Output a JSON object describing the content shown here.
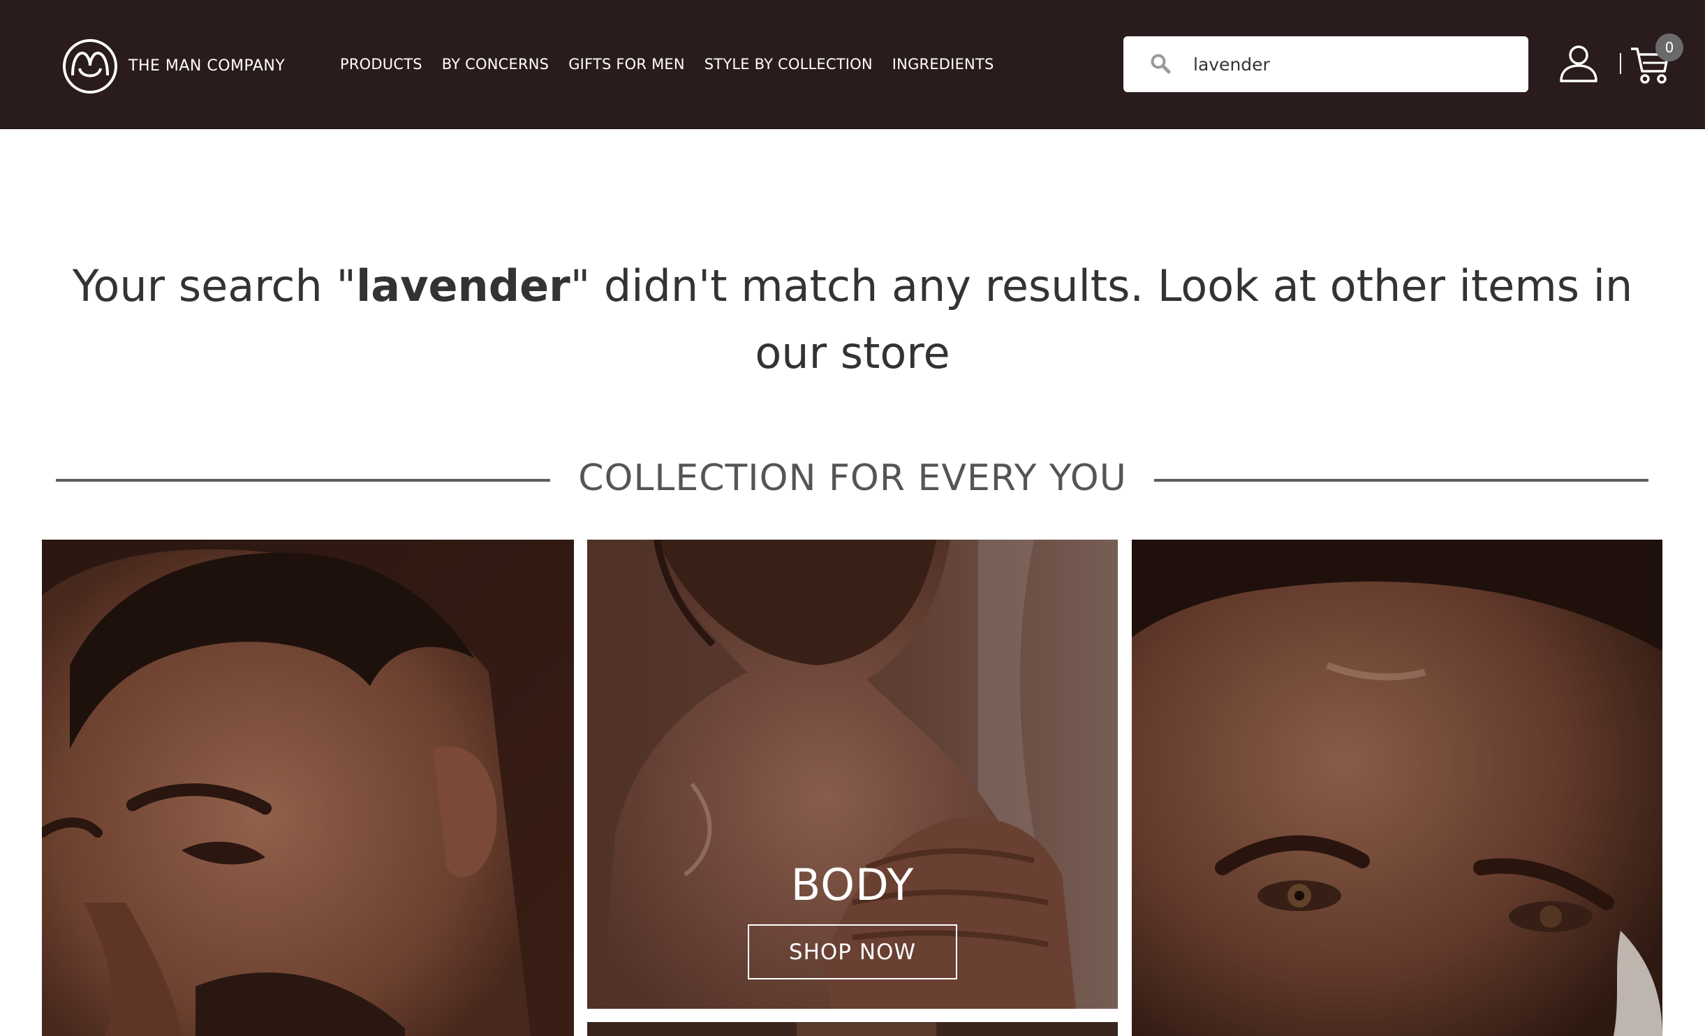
{
  "brand": {
    "name": "THE MAN COMPANY"
  },
  "nav": {
    "items": [
      {
        "label": "PRODUCTS"
      },
      {
        "label": "BY CONCERNS"
      },
      {
        "label": "GIFTS FOR MEN"
      },
      {
        "label": "STYLE BY COLLECTION"
      },
      {
        "label": "INGREDIENTS"
      }
    ]
  },
  "search": {
    "value": "lavender"
  },
  "cart": {
    "count": "0"
  },
  "message": {
    "prefix": "Your search \"",
    "query": "lavender",
    "suffix": "\" didn't match any results. Look at other items in our store"
  },
  "section": {
    "title": "COLLECTION FOR EVERY YOU"
  },
  "tiles": [
    {
      "label": "",
      "button": ""
    },
    {
      "label": "BODY",
      "button": "SHOP NOW"
    },
    {
      "label": "",
      "button": ""
    }
  ],
  "colors": {
    "header_bg": "#2a1b1c",
    "text_dark": "#333333",
    "section_text": "#555555"
  }
}
